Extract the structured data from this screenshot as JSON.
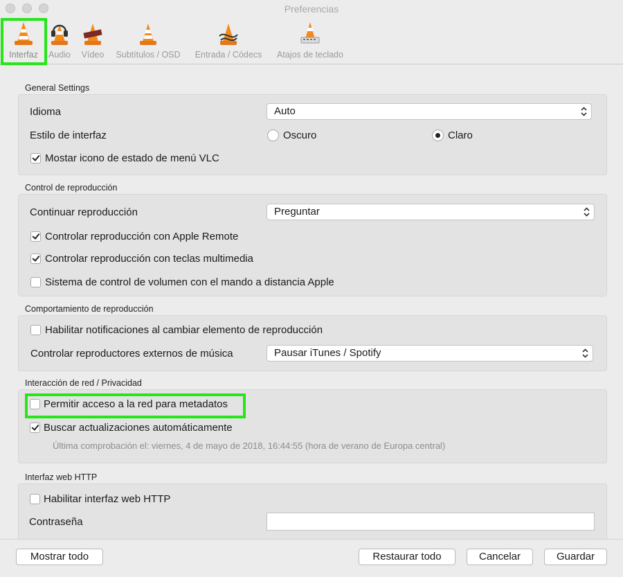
{
  "window": {
    "title": "Preferencias"
  },
  "toolbar": {
    "tabs": [
      {
        "label": "Interfaz",
        "icon": "vlc-cone-icon",
        "selected": true
      },
      {
        "label": "Audio",
        "icon": "vlc-cone-headphones-icon"
      },
      {
        "label": "Vídeo",
        "icon": "vlc-cone-film-icon"
      },
      {
        "label": "Subtítulos / OSD",
        "icon": "vlc-cone-subtitles-icon"
      },
      {
        "label": "Entrada / Códecs",
        "icon": "vlc-cone-cables-icon"
      },
      {
        "label": "Atajos de teclado",
        "icon": "vlc-cone-keyboard-icon"
      }
    ]
  },
  "general": {
    "title": "General Settings",
    "language_label": "Idioma",
    "language_value": "Auto",
    "style_label": "Estilo de interfaz",
    "style_dark": "Oscuro",
    "style_light": "Claro",
    "style_selected": "Claro",
    "menu_icon_label": "Mostar icono de estado de menú VLC",
    "menu_icon_checked": true
  },
  "playback": {
    "title": "Control de reproducción",
    "continue_label": "Continuar reproducción",
    "continue_value": "Preguntar",
    "apple_remote_label": "Controlar reproducción con Apple Remote",
    "apple_remote_checked": true,
    "media_keys_label": "Controlar reproducción con teclas multimedia",
    "media_keys_checked": true,
    "volume_remote_label": "Sistema de control de volumen con el mando a distancia Apple",
    "volume_remote_checked": false
  },
  "behavior": {
    "title": "Comportamiento de reproducción",
    "notifications_label": "Habilitar notificaciones al cambiar elemento de reproducción",
    "notifications_checked": false,
    "external_label": "Controlar reproductores externos de música",
    "external_value": "Pausar iTunes / Spotify"
  },
  "network": {
    "title": "Interacción de red / Privacidad",
    "metadata_label": "Permitir acceso a la red para metadatos",
    "metadata_checked": false,
    "updates_label": "Buscar actualizaciones automáticamente",
    "updates_checked": true,
    "last_check": "Última comprobación el: viernes, 4 de mayo de 2018, 16:44:55 (hora de verano de Europa central)"
  },
  "http": {
    "title": "Interfaz web HTTP",
    "enable_label": "Habilitar interfaz web HTTP",
    "enable_checked": false,
    "password_label": "Contraseña",
    "password_value": ""
  },
  "footer": {
    "show_all": "Mostrar todo",
    "restore_all": "Restaurar todo",
    "cancel": "Cancelar",
    "save": "Guardar"
  },
  "colors": {
    "highlight": "#26e61a",
    "cone_orange": "#f28a1c"
  }
}
